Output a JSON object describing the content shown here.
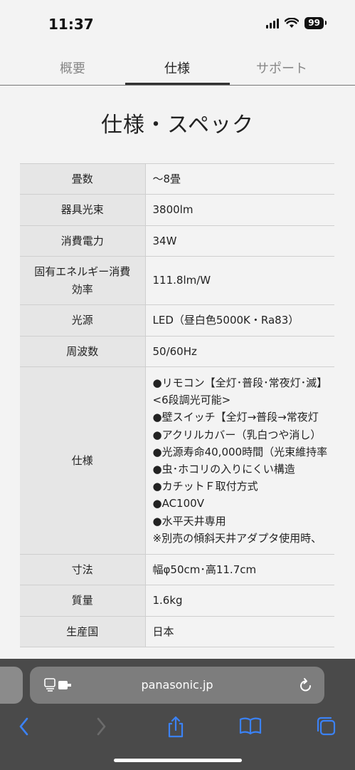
{
  "status": {
    "time": "11:37",
    "battery": "99"
  },
  "tabs": [
    {
      "label": "概要"
    },
    {
      "label": "仕様"
    },
    {
      "label": "サポート"
    }
  ],
  "page_title": "仕様・スペック",
  "spec": {
    "rows": [
      {
        "label": [
          "畳数"
        ],
        "value": [
          "〜8畳"
        ]
      },
      {
        "label": [
          "器具光束"
        ],
        "value": [
          "3800lm"
        ]
      },
      {
        "label": [
          "消費電力"
        ],
        "value": [
          "34W"
        ]
      },
      {
        "label": [
          "固有エネルギー消費",
          "効率"
        ],
        "value": [
          "111.8lm/W"
        ]
      },
      {
        "label": [
          "光源"
        ],
        "value": [
          "LED（昼白色5000K・Ra83）"
        ]
      },
      {
        "label": [
          "周波数"
        ],
        "value": [
          "50/60Hz"
        ]
      },
      {
        "label": [
          "仕様"
        ],
        "value": [
          "●リモコン【全灯･普段･常夜灯･滅】",
          "<6段調光可能>",
          "●壁スイッチ【全灯→普段→常夜灯",
          "●アクリルカバー（乳白つや消し）",
          "●光源寿命40,000時間（光束維持率",
          "●虫･ホコリの入りにくい構造",
          "●カチットＦ取付方式",
          "●AC100V",
          "●水平天井専用",
          "※別売の傾斜天井アダプタ使用時、"
        ]
      },
      {
        "label": [
          "寸法"
        ],
        "value": [
          "幅φ50cm･高11.7cm"
        ]
      },
      {
        "label": [
          "質量"
        ],
        "value": [
          "1.6kg"
        ]
      },
      {
        "label": [
          "生産国"
        ],
        "value": [
          "日本"
        ]
      }
    ]
  },
  "browser": {
    "url": "panasonic.jp"
  }
}
